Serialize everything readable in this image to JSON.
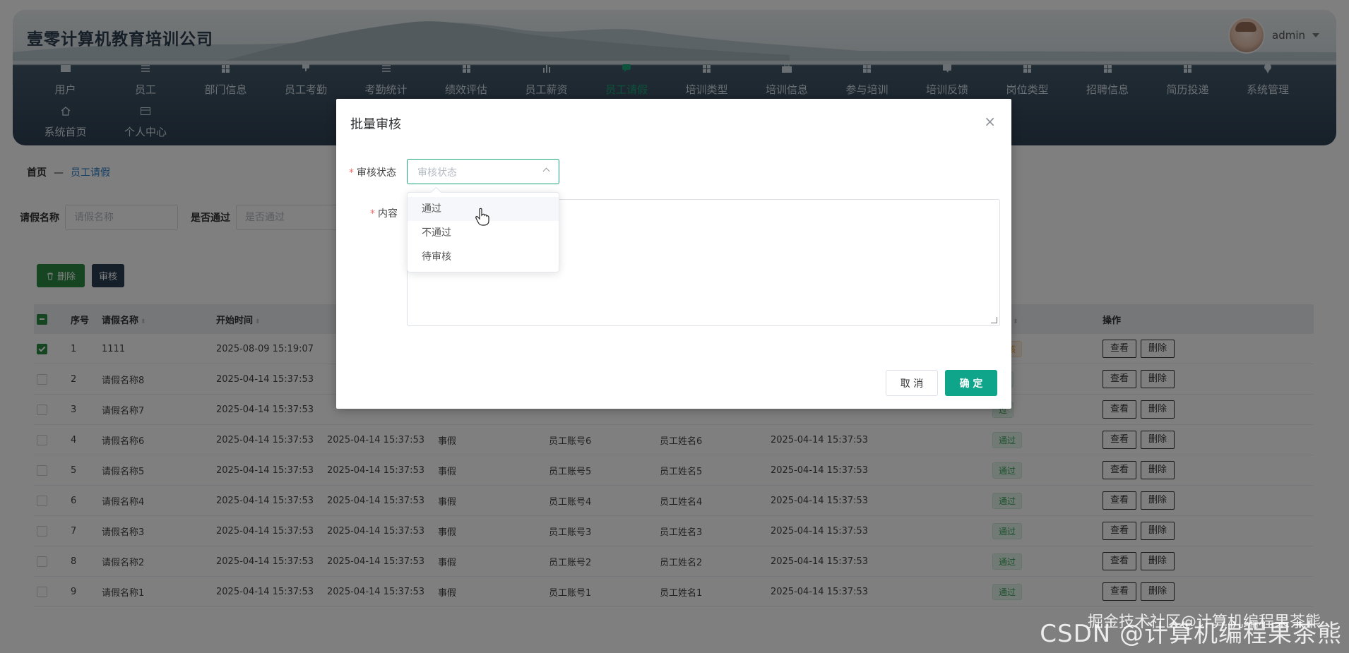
{
  "header": {
    "title": "壹零计算机教育培训公司",
    "user": "admin"
  },
  "nav": [
    {
      "label": "用户",
      "icon": "id-card-icon"
    },
    {
      "label": "员工",
      "icon": "list-icon"
    },
    {
      "label": "部门信息",
      "icon": "grid-icon"
    },
    {
      "label": "员工考勤",
      "icon": "stamp-icon"
    },
    {
      "label": "考勤统计",
      "icon": "list-icon"
    },
    {
      "label": "绩效评估",
      "icon": "grid-icon"
    },
    {
      "label": "员工薪资",
      "icon": "bar-chart-icon"
    },
    {
      "label": "员工请假",
      "icon": "chat-icon",
      "active": true
    },
    {
      "label": "培训类型",
      "icon": "grid-icon"
    },
    {
      "label": "培训信息",
      "icon": "briefcase-icon"
    },
    {
      "label": "参与培训",
      "icon": "grid-icon"
    },
    {
      "label": "培训反馈",
      "icon": "comment-icon"
    },
    {
      "label": "岗位类型",
      "icon": "grid-icon"
    },
    {
      "label": "招聘信息",
      "icon": "grid-icon"
    },
    {
      "label": "简历投递",
      "icon": "grid-icon"
    },
    {
      "label": "系统管理",
      "icon": "pin-icon"
    },
    {
      "label": "系统首页",
      "icon": "home-icon"
    },
    {
      "label": "个人中心",
      "icon": "card-icon"
    }
  ],
  "breadcrumb": {
    "home": "首页",
    "sep": "—",
    "current": "员工请假"
  },
  "search": {
    "name_label": "请假名称",
    "name_placeholder": "请假名称",
    "pass_label": "是否通过",
    "pass_placeholder": "是否通过"
  },
  "toolbar": {
    "delete_label": "删除",
    "audit_label": "审核"
  },
  "table": {
    "headers": {
      "no": "序号",
      "name": "请假名称",
      "start": "开始时间",
      "status": "状态",
      "op": "操作"
    },
    "view_label": "查看",
    "delete_label": "删除",
    "rows": [
      {
        "no": "1",
        "name": "1111",
        "start": "2025-08-09 15:19:07",
        "end": "",
        "type": "",
        "account": "",
        "emp": "",
        "time": "",
        "status": "审核",
        "checked": true,
        "wait": true
      },
      {
        "no": "2",
        "name": "请假名称8",
        "start": "2025-04-14 15:37:53",
        "end": "",
        "type": "",
        "account": "",
        "emp": "",
        "time": "",
        "status": "过"
      },
      {
        "no": "3",
        "name": "请假名称7",
        "start": "2025-04-14 15:37:53",
        "end": "",
        "type": "",
        "account": "",
        "emp": "",
        "time": "",
        "status": "过"
      },
      {
        "no": "4",
        "name": "请假名称6",
        "start": "2025-04-14 15:37:53",
        "end": "2025-04-14 15:37:53",
        "type": "事假",
        "account": "员工账号6",
        "emp": "员工姓名6",
        "time": "2025-04-14 15:37:53",
        "status": "通过"
      },
      {
        "no": "5",
        "name": "请假名称5",
        "start": "2025-04-14 15:37:53",
        "end": "2025-04-14 15:37:53",
        "type": "事假",
        "account": "员工账号5",
        "emp": "员工姓名5",
        "time": "2025-04-14 15:37:53",
        "status": "通过"
      },
      {
        "no": "6",
        "name": "请假名称4",
        "start": "2025-04-14 15:37:53",
        "end": "2025-04-14 15:37:53",
        "type": "事假",
        "account": "员工账号4",
        "emp": "员工姓名4",
        "time": "2025-04-14 15:37:53",
        "status": "通过"
      },
      {
        "no": "7",
        "name": "请假名称3",
        "start": "2025-04-14 15:37:53",
        "end": "2025-04-14 15:37:53",
        "type": "事假",
        "account": "员工账号3",
        "emp": "员工姓名3",
        "time": "2025-04-14 15:37:53",
        "status": "通过"
      },
      {
        "no": "8",
        "name": "请假名称2",
        "start": "2025-04-14 15:37:53",
        "end": "2025-04-14 15:37:53",
        "type": "事假",
        "account": "员工账号2",
        "emp": "员工姓名2",
        "time": "2025-04-14 15:37:53",
        "status": "通过"
      },
      {
        "no": "9",
        "name": "请假名称1",
        "start": "2025-04-14 15:37:53",
        "end": "2025-04-14 15:37:53",
        "type": "事假",
        "account": "员工账号1",
        "emp": "员工姓名1",
        "time": "2025-04-14 15:37:53",
        "status": "通过"
      }
    ]
  },
  "dialog": {
    "title": "批量审核",
    "status_label": "审核状态",
    "status_placeholder": "审核状态",
    "content_label": "内容",
    "cancel_label": "取 消",
    "ok_label": "确 定",
    "options": [
      "通过",
      "不通过",
      "待审核"
    ]
  },
  "watermark": {
    "line1": "掘金技术社区@计算机编程果茶熊",
    "line2": "CSDN @计算机编程果茶熊"
  },
  "colors": {
    "accent": "#1aa577",
    "primary_dark": "#2b3f55",
    "danger_green": "#2c8a45",
    "ok": "#0ea58a"
  }
}
